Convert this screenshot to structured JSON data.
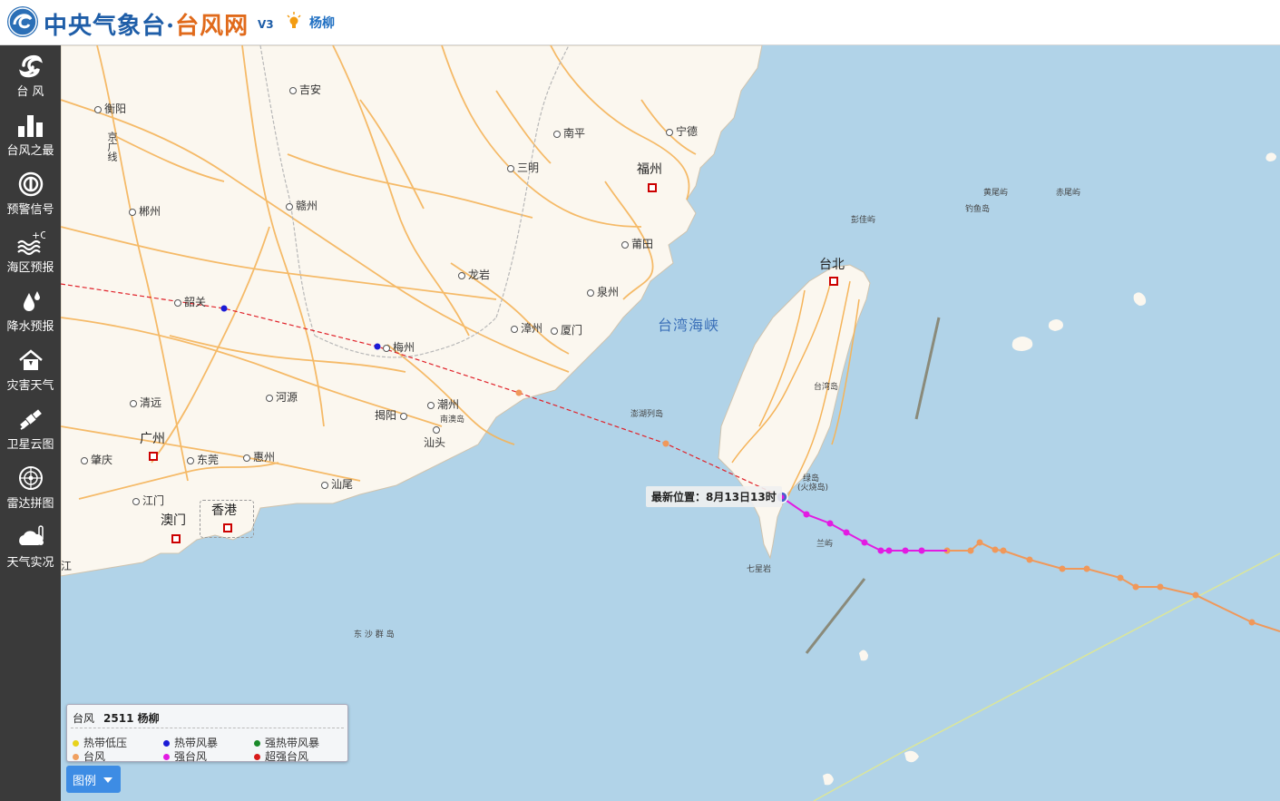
{
  "header": {
    "logo_main": "中央气象台·",
    "logo_accent": "台风网",
    "version": "V3",
    "storm_name": "杨柳"
  },
  "sidebar": {
    "items": [
      {
        "label": "台 风",
        "icon": "typhoon-icon"
      },
      {
        "label": "台风之最",
        "icon": "bar-chart-icon"
      },
      {
        "label": "预警信号",
        "icon": "warning-signal-icon"
      },
      {
        "label": "海区预报",
        "icon": "sea-temperature-icon"
      },
      {
        "label": "降水预报",
        "icon": "raindrop-icon"
      },
      {
        "label": "灾害天气",
        "icon": "disaster-house-icon"
      },
      {
        "label": "卫星云图",
        "icon": "satellite-icon"
      },
      {
        "label": "雷达拼图",
        "icon": "radar-icon"
      },
      {
        "label": "天气实况",
        "icon": "weather-live-icon"
      }
    ]
  },
  "map": {
    "places": {
      "jian": "吉安",
      "hengyang": "衡阳",
      "nanping": "南平",
      "ningde": "宁德",
      "sanming": "三明",
      "fuzhou": "福州",
      "chenzhou": "郴州",
      "ganzhou": "赣州",
      "putian": "莆田",
      "longyan": "龙岩",
      "quanzhou": "泉州",
      "shaoguan": "韶关",
      "meizhou": "梅州",
      "zhangzhou": "漳州",
      "xiamen": "厦门",
      "qingyuan": "清远",
      "heyuan": "河源",
      "chaozhou": "潮州",
      "jieyang": "揭阳",
      "nanaodao": "南澳岛",
      "shantou": "汕头",
      "guangzhou": "广州",
      "zhaoqing": "肇庆",
      "dongguan": "东莞",
      "huizhou": "惠州",
      "shanwei": "汕尾",
      "jiangmen": "江门",
      "macau": "澳门",
      "hongkong": "香港",
      "jiang": "江",
      "taibei": "台北",
      "taiwandao": "台湾岛",
      "penghu": "澎湖列岛",
      "lvdao": "绿岛",
      "huoshao": "(火烧岛)",
      "lanyu": "兰屿",
      "qixingyan": "七星岩",
      "dongsha": "东 沙 群 岛",
      "pengjiayu": "彭佳屿",
      "diaoyudao": "钓鱼岛",
      "huangweiyu": "黄尾屿",
      "chiweiyu": "赤尾屿",
      "jingguang": "京广线"
    },
    "sea_name": "台湾海峡",
    "latest_position": "最新位置：8月13日13时"
  },
  "legend": {
    "label": "台风",
    "storm": "2511 杨柳",
    "items": [
      {
        "label": "热带低压",
        "color": "#e8d31c"
      },
      {
        "label": "热带风暴",
        "color": "#1b1bd6"
      },
      {
        "label": "强热带风暴",
        "color": "#1a8a2a"
      },
      {
        "label": "台风",
        "color": "#f0a060"
      },
      {
        "label": "强台风",
        "color": "#e21be2"
      },
      {
        "label": "超强台风",
        "color": "#d81b1b"
      }
    ],
    "button": "图例"
  },
  "colors": {
    "sea": "#b1d3e8",
    "land": "#fbf7ef",
    "road": "#f5b45a",
    "forecast": "#e0222a",
    "typhoon_track": "#f0985a",
    "strong_typhoon_track": "#e21be2"
  }
}
